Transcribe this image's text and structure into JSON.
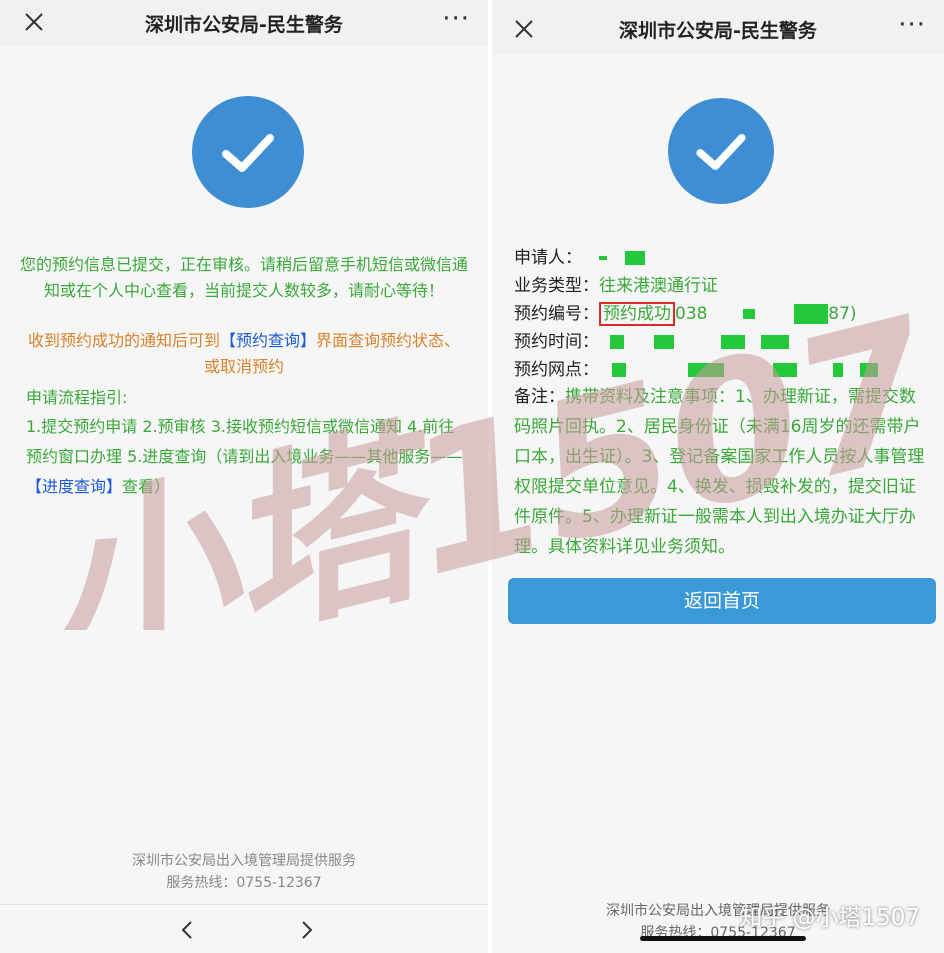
{
  "left": {
    "title": "深圳市公安局-民生警务",
    "more": "···",
    "msg_green": "您的预约信息已提交，正在审核。请稍后留意手机短信或微信通知或在个人中心查看，当前提交人数较多，请耐心等待！",
    "msg_orange_prefix": "收到预约成功的通知后可到",
    "msg_orange_link": "【预约查询】",
    "msg_orange_suffix": "界面查询预约状态、或取消预约",
    "guide_title": "申请流程指引:",
    "guide_text": "1.提交预约申请 2.预审核 3.接收预约短信或微信通知 4.前往预约窗口办理 5.进度查询（请到出入境业务——其他服务——",
    "guide_link": "【进度查询】",
    "guide_suffix": "查看）",
    "footer_line1": "深圳市公安局出入境管理局提供服务",
    "footer_line2": "服务热线：0755-12367"
  },
  "right": {
    "title": "深圳市公安局-民生警务",
    "more": "···",
    "applicant_label": "申请人：",
    "business_label": "业务类型：",
    "business_value": "往来港澳通行证",
    "number_label": "预约编号：",
    "number_status": "预约成功",
    "number_prefix": "038",
    "number_suffix": "87)",
    "time_label": "预约时间：",
    "site_label": "预约网点：",
    "remark_label": "备注：",
    "remark_text": "携带资料及注意事项：1、办理新证，需提交数码照片回执。2、居民身份证（未满16周岁的还需带户口本，出生证）。3、登记备案国家工作人员按人事管理权限提交单位意见。4、换发、损毁补发的，提交旧证件原件。5、办理新证一般需本人到出入境办证大厅办理。具体资料详见业务须知。",
    "home_button": "返回首页",
    "footer_line1": "深圳市公安局出入境管理局提供服务",
    "footer_line2": "服务热线：0755-12367"
  },
  "watermark": "小塔1507",
  "credit": "知乎 @小塔1507",
  "colors": {
    "accent_blue": "#3e8ed3",
    "button_blue": "#3a9ad8",
    "text_green": "#3aa93a",
    "text_orange": "#d9822b",
    "link_blue": "#1d5bd6",
    "highlight_red": "#d92b2b",
    "watermark": "#c89a9a"
  },
  "icons": [
    "close-icon",
    "more-icon",
    "checkmark-icon",
    "chevron-left-icon",
    "chevron-right-icon"
  ]
}
